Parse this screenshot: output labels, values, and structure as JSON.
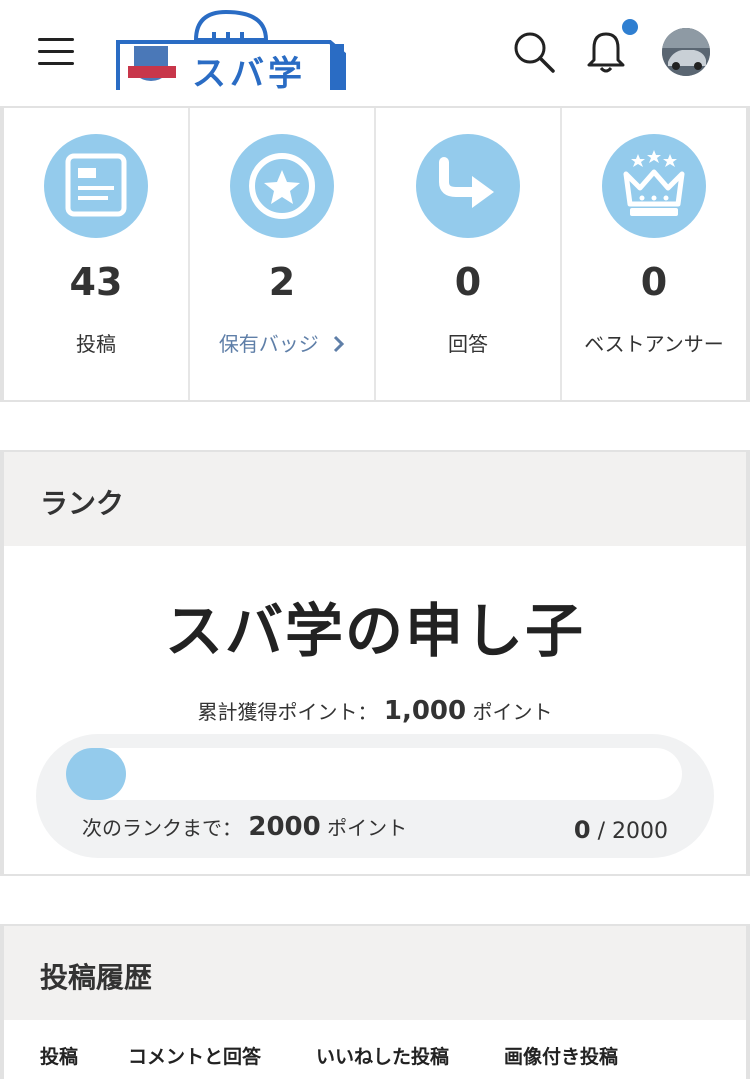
{
  "header": {
    "logo_text": "スバ学",
    "logo_badge": "スバ学",
    "colors": {
      "logo_blue": "#2a6cc4",
      "notification_dot": "#2f7fd1"
    }
  },
  "stats": [
    {
      "value": "43",
      "label": "投稿",
      "icon": "post-icon"
    },
    {
      "value": "2",
      "label": "保有バッジ",
      "icon": "badge-star-icon",
      "link": true
    },
    {
      "value": "0",
      "label": "回答",
      "icon": "answer-arrow-icon"
    },
    {
      "value": "0",
      "label": "ベストアンサー",
      "icon": "crown-icon"
    }
  ],
  "rank": {
    "section_title": "ランク",
    "rank_name": "スバ学の申し子",
    "total_label": "累計獲得ポイント：",
    "total_value": "1,000",
    "total_unit": "ポイント",
    "next_label": "次のランクまで：",
    "next_value": "2000",
    "next_unit": "ポイント",
    "progress_current": "0",
    "progress_sep": " / ",
    "progress_max": "2000",
    "progress_fraction": 0,
    "colors": {
      "accent": "#94cbec"
    }
  },
  "history": {
    "section_title": "投稿履歴",
    "tabs": [
      "投稿",
      "コメントと回答",
      "いいねした投稿",
      "画像付き投稿"
    ]
  }
}
